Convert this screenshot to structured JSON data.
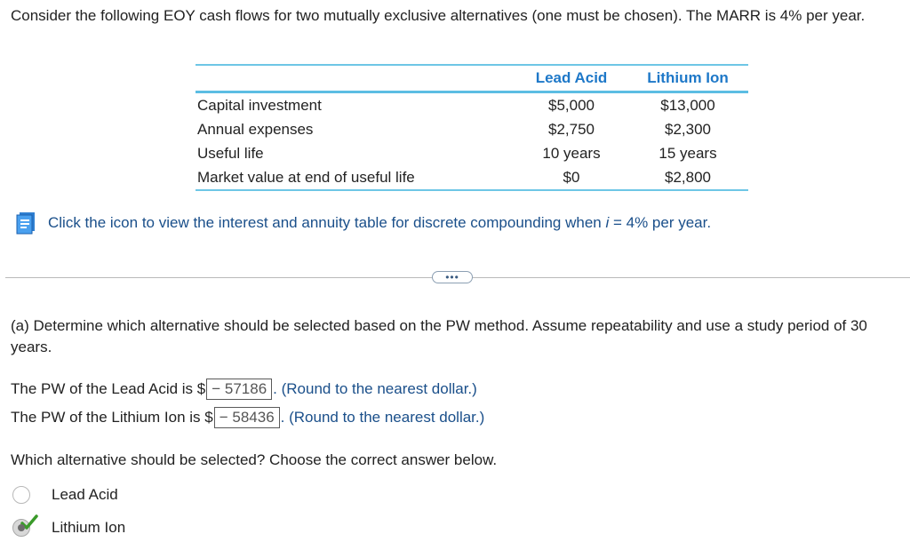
{
  "intro_text": "Consider the following EOY cash flows for two mutually exclusive alternatives (one must be chosen). The MARR is 4% per year.",
  "table": {
    "headers": [
      "",
      "Lead Acid",
      "Lithium Ion"
    ],
    "rows": [
      {
        "label": "Capital investment",
        "lead": "$5,000",
        "lithium": "$13,000"
      },
      {
        "label": "Annual expenses",
        "lead": "$2,750",
        "lithium": "$2,300"
      },
      {
        "label": "Useful life",
        "lead": "10 years",
        "lithium": "15 years"
      },
      {
        "label": "Market value at end of useful life",
        "lead": "$0",
        "lithium": "$2,800"
      }
    ]
  },
  "reference": {
    "icon": "book-icon",
    "text_before": "Click the icon to view the interest and annuity table for discrete compounding when ",
    "var": "i",
    "text_after": " = 4% per year."
  },
  "expand_button": "•••",
  "part_a": {
    "question": "(a) Determine which alternative should be selected based on the PW method. Assume repeatability and use a study period of 30 years.",
    "pw_lead_prefix": "The PW of the Lead Acid is $",
    "pw_lead_value": "− 57186",
    "pw_lithium_prefix": "The PW of the Lithium Ion is $",
    "pw_lithium_value": "− 58436",
    "hint": ". (Round to the nearest dollar.)",
    "choose_prompt": "Which alternative should be selected? Choose the correct answer below.",
    "options": [
      {
        "label": "Lead Acid",
        "selected": false
      },
      {
        "label": "Lithium Ion",
        "selected": true
      }
    ]
  },
  "colors": {
    "header_blue": "#1e78c8",
    "rule_blue": "#5cbde3",
    "link_blue": "#1a4f8a",
    "check_green": "#3a9a2a"
  }
}
